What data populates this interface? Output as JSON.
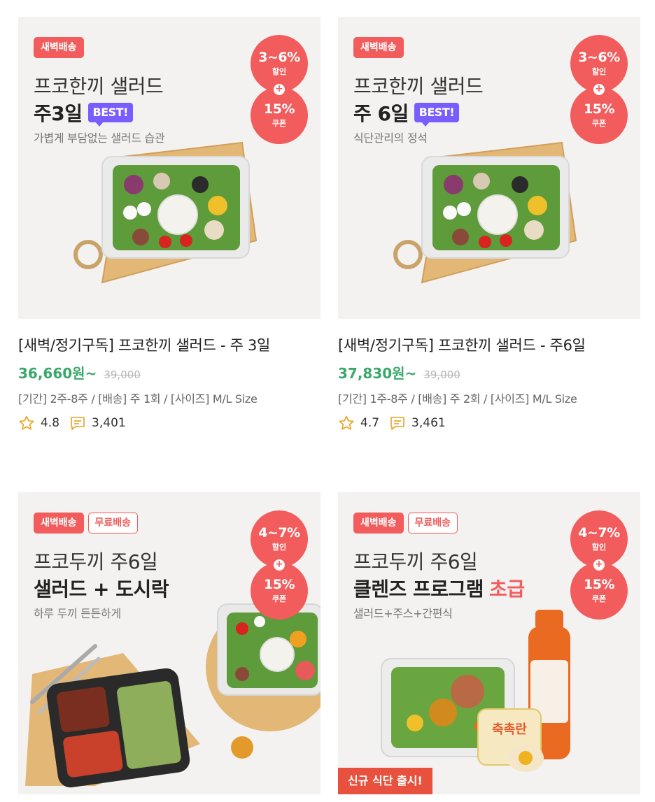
{
  "products": [
    {
      "tags": [
        "새벽배송"
      ],
      "headline_line1": "프코한끼 샐러드",
      "headline_line2": "주3일",
      "headline_line2_accent": "",
      "best_badge": "BEST!",
      "subtitle": "가볍게 부담없는 샐러드 습관",
      "discount_pct": "3~6%",
      "discount_label": "할인",
      "coupon_pct": "15%",
      "coupon_label": "쿠폰",
      "new_label": "",
      "title": "[새벽/정기구독] 프코한끼 샐러드 - 주 3일",
      "price": "36,660원~",
      "original_price": "39,000",
      "options": "[기간] 2주-8주 / [배송] 주 1회 / [사이즈] M/L Size",
      "rating": "4.8",
      "review_count": "3,401",
      "image": "salad-box-on-cutting-board"
    },
    {
      "tags": [
        "새벽배송"
      ],
      "headline_line1": "프코한끼 샐러드",
      "headline_line2": "주 6일",
      "headline_line2_accent": "",
      "best_badge": "BEST!",
      "subtitle": "식단관리의 정석",
      "discount_pct": "3~6%",
      "discount_label": "할인",
      "coupon_pct": "15%",
      "coupon_label": "쿠폰",
      "new_label": "",
      "title": "[새벽/정기구독] 프코한끼 샐러드 - 주6일",
      "price": "37,830원~",
      "original_price": "39,000",
      "options": "[기간] 1주-8주 / [배송] 주 2회 / [사이즈] M/L Size",
      "rating": "4.7",
      "review_count": "3,461",
      "image": "salad-box-on-cutting-board"
    },
    {
      "tags": [
        "새벽배송",
        "무료배송"
      ],
      "headline_line1": "프코두끼 주6일",
      "headline_line2": "샐러드 + 도시락",
      "headline_line2_accent": "",
      "best_badge": "",
      "subtitle": "하루 두끼 든든하게",
      "discount_pct": "4~7%",
      "discount_label": "할인",
      "coupon_pct": "15%",
      "coupon_label": "쿠폰",
      "new_label": "",
      "image": "salad-and-lunchbox"
    },
    {
      "tags": [
        "새벽배송",
        "무료배송"
      ],
      "headline_line1": "프코두끼 주6일",
      "headline_line2": "클렌즈 프로그램",
      "headline_line2_accent": "초급",
      "best_badge": "",
      "subtitle": "샐러드+주스+간편식",
      "discount_pct": "4~7%",
      "discount_label": "할인",
      "coupon_pct": "15%",
      "coupon_label": "쿠폰",
      "new_label": "신규 식단 출시!",
      "image": "salad-juice-eggs"
    }
  ],
  "colors": {
    "brand_red": "#f25c5c",
    "price_green": "#3aa86b",
    "best_purple": "#7b5cff"
  },
  "icons": [
    "star-outline-icon",
    "comment-icon"
  ]
}
